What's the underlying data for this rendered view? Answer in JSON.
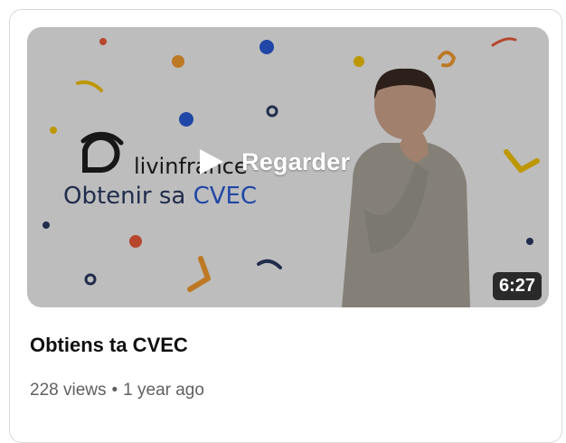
{
  "video": {
    "overlay_label": "Regarder",
    "duration": "6:27",
    "title": "Obtiens ta CVEC",
    "views": "228 views",
    "separator": "•",
    "age": "1 year ago"
  },
  "thumbnail": {
    "brand": "livinfrance",
    "headline_part1": "Obtenir sa ",
    "headline_part2": "CVEC"
  },
  "colors": {
    "thumb_bg": "#efefef",
    "accent_blue": "#2a5bd7",
    "dark_blue": "#2b3a63",
    "orange": "#f29b30",
    "yellow": "#f2c200",
    "red_dot": "#ea5b3a"
  },
  "icons": {
    "play": "play-icon",
    "brand_logo": "livinfrance-logo-icon"
  }
}
